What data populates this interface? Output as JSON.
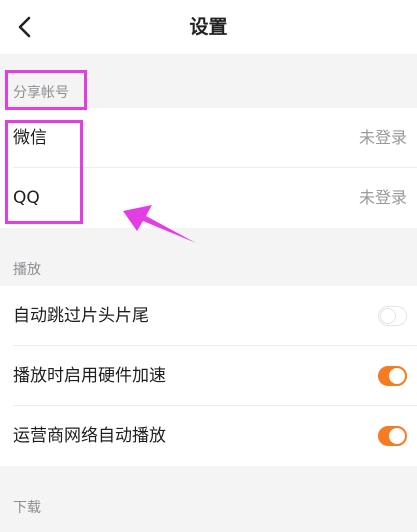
{
  "header": {
    "title": "设置",
    "back_icon": "chevron-left-icon"
  },
  "sections": {
    "share_accounts": {
      "header": "分享帐号",
      "items": [
        {
          "label": "微信",
          "value": "未登录"
        },
        {
          "label": "QQ",
          "value": "未登录"
        }
      ]
    },
    "playback": {
      "header": "播放",
      "items": [
        {
          "label": "自动跳过片头片尾",
          "toggle": false
        },
        {
          "label": "播放时启用硬件加速",
          "toggle": true
        },
        {
          "label": "运营商网络自动播放",
          "toggle": true
        }
      ]
    },
    "download": {
      "header": "下载"
    }
  },
  "colors": {
    "toggle_on": "#f57c22",
    "annotation": "#e33ee3",
    "background": "#f4f4f5"
  }
}
